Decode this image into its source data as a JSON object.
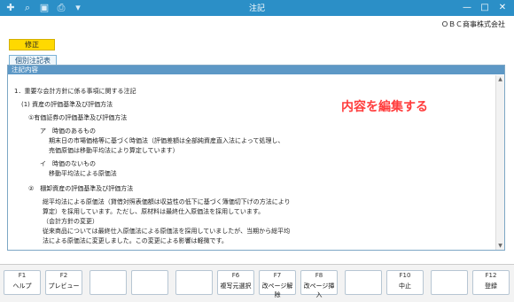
{
  "window": {
    "title": "注記",
    "controls": {
      "minimize": "—",
      "maximize": "□",
      "close": "✕"
    }
  },
  "toolbar": {
    "icons": [
      "add-icon",
      "zoom-icon",
      "layout-icon",
      "print-icon",
      "dropdown-icon"
    ]
  },
  "header": {
    "company": "ＯＢＣ商事株式会社",
    "mode_badge": "修正",
    "tab_label": "個別注記表"
  },
  "panel": {
    "header": "注記内容",
    "lines": [
      "1．重要な会計方針に係る事項に関する注記",
      "(1) 資産の評価基準及び評価方法",
      "①有価証券の評価基準及び評価方法",
      "ア　時価のあるもの",
      "期末日の市場価格等に基づく時価法（評価差額は全部純資産直入法によって処理し、",
      "売価原価は移動平均法により算定しています）",
      "イ　時価のないもの",
      "移動平均法による原価法",
      "②　棚卸資産の評価基準及び評価方法",
      "総平均法による原価法（貸借対照表価額は収益性の低下に基づく簿価切下げの方法により",
      "算定）を採用しています。ただし、原材料は最終仕入原価法を採用しています。",
      "（会計方針の変更）",
      "従来商品については最終仕入原価法による原価法を採用していましたが、当期から総平均",
      "法による原価法に変更しました。この変更による影響は軽微です。"
    ]
  },
  "annotation": "内容を編集する",
  "fkeys": [
    {
      "key": "F1",
      "label": "ヘルプ"
    },
    {
      "key": "F2",
      "label": "プレビュー"
    },
    {
      "key": "",
      "label": ""
    },
    {
      "key": "",
      "label": ""
    },
    {
      "key": "",
      "label": ""
    },
    {
      "key": "F6",
      "label": "複写元選択"
    },
    {
      "key": "F7",
      "label": "改ページ解除"
    },
    {
      "key": "F8",
      "label": "改ページ挿入"
    },
    {
      "key": "",
      "label": ""
    },
    {
      "key": "F10",
      "label": "中止"
    },
    {
      "key": "",
      "label": ""
    },
    {
      "key": "F12",
      "label": "登録"
    }
  ]
}
